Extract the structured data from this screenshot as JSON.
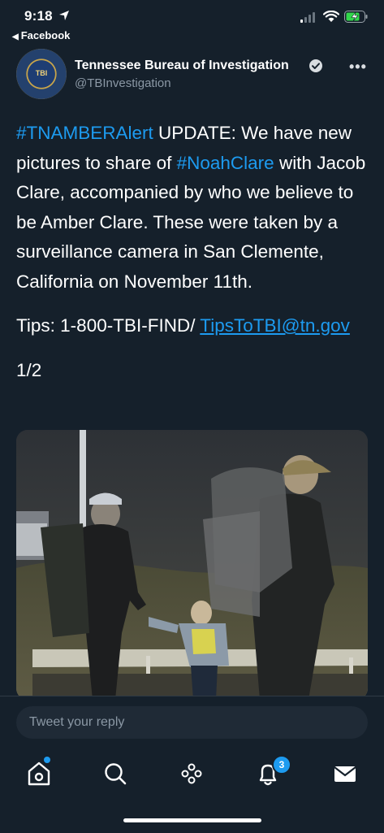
{
  "status_bar": {
    "time": "9:18",
    "back_app": "Facebook"
  },
  "tweet": {
    "display_name": "Tennessee Bureau of Investigation",
    "handle": "@TBInvestigation",
    "avatar_text": "TBI",
    "hashtag_1": "#TNAMBERAlert",
    "text_1": " UPDATE: We have new pictures to share of ",
    "hashtag_2": "#NoahClare",
    "text_2": " with Jacob Clare, accompanied by who we believe to be Amber Clare. These were taken by a surveillance camera in San Clemente, California on November 11th.",
    "tips_text": "Tips: 1-800-TBI-FIND/ ",
    "tips_email": "TipsToTBI@tn.gov",
    "count": "1/2"
  },
  "reply": {
    "placeholder": "Tweet your reply"
  },
  "tabbar": {
    "notifications_badge": "3"
  },
  "colors": {
    "background": "#15202b",
    "link": "#1d9bf0",
    "secondary_text": "#8b98a5"
  }
}
